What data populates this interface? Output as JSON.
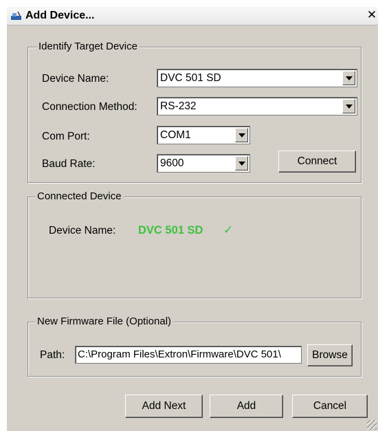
{
  "window": {
    "title": "Add Device...",
    "close_label": "✕"
  },
  "identify": {
    "legend": "Identify Target Device",
    "device_name_label": "Device Name:",
    "device_name_value": "DVC 501 SD",
    "connection_label": "Connection Method:",
    "connection_value": "RS-232",
    "com_port_label": "Com Port:",
    "com_port_value": "COM1",
    "baud_label": "Baud Rate:",
    "baud_value": "9600",
    "connect_label": "Connect"
  },
  "connected": {
    "legend": "Connected Device",
    "device_name_label": "Device Name:",
    "device_name_value": "DVC 501 SD",
    "status_mark": "✓",
    "status_color": "#3ec13e"
  },
  "firmware": {
    "legend": "New Firmware File (Optional)",
    "path_label": "Path:",
    "path_value": "C:\\Program Files\\Extron\\Firmware\\DVC 501\\",
    "browse_label": "Browse"
  },
  "footer": {
    "add_next_label": "Add Next",
    "add_label": "Add",
    "cancel_label": "Cancel"
  }
}
